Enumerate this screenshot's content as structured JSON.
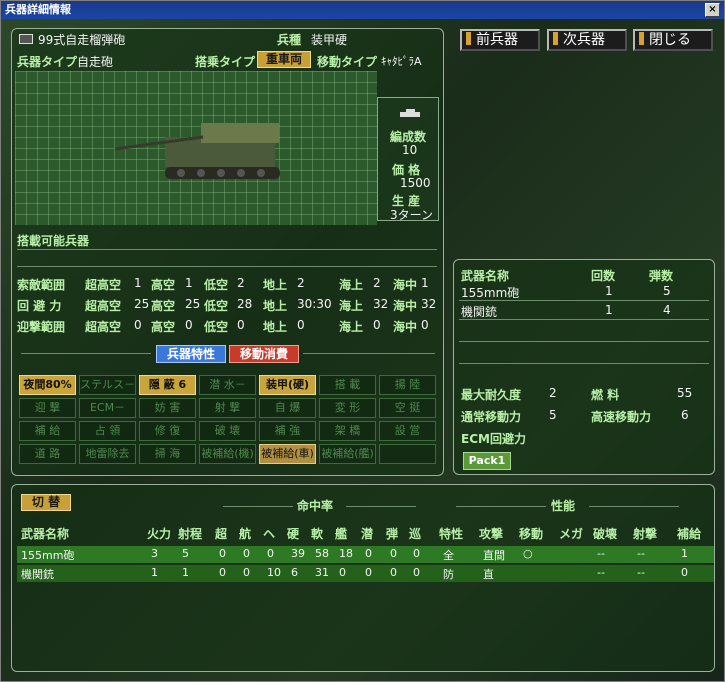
{
  "window": {
    "title": "兵器詳細情報",
    "close_glyph": "×"
  },
  "nav": {
    "prev": "前兵器",
    "next": "次兵器",
    "close": "閉じる"
  },
  "unit": {
    "name": "99式自走榴弾砲",
    "branch_label": "兵種",
    "branch": "装甲硬",
    "type_label": "兵器タイプ",
    "type": "自走砲",
    "boarding_label": "搭乗タイプ",
    "boarding": "重車両",
    "move_label": "移動タイプ",
    "move": "ｷｬﾀﾋﾟﾗA",
    "formation_label": "編成数",
    "formation": "10",
    "price_label": "価 格",
    "price": "1500",
    "production_label": "生 産",
    "production": "3ターン",
    "loadable_label": "搭載可能兵器"
  },
  "combat": {
    "search": {
      "label": "索敵範囲",
      "vals": [
        [
          "超高空",
          "1"
        ],
        [
          "高空",
          "1"
        ],
        [
          "低空",
          "2"
        ],
        [
          "地上",
          "2"
        ],
        [
          "海上",
          "2"
        ],
        [
          "海中",
          "1"
        ]
      ]
    },
    "evasion": {
      "label": "回 避 力",
      "vals": [
        [
          "超高空",
          "25"
        ],
        [
          "高空",
          "25"
        ],
        [
          "低空",
          "28"
        ],
        [
          "地上",
          "30:30"
        ],
        [
          "海上",
          "32"
        ],
        [
          "海中",
          "32"
        ]
      ]
    },
    "intercept": {
      "label": "迎撃範囲",
      "vals": [
        [
          "超高空",
          "0"
        ],
        [
          "高空",
          "0"
        ],
        [
          "低空",
          "0"
        ],
        [
          "地上",
          "0"
        ],
        [
          "海上",
          "0"
        ],
        [
          "海中",
          "0"
        ]
      ]
    }
  },
  "tabs": {
    "traits": "兵器特性",
    "move_cost": "移動消費"
  },
  "traits": [
    [
      "夜間80%",
      "ステルス－",
      "隠 蔽 6",
      "潜 水－",
      "装甲(硬)",
      "搭 載",
      "揚 陸"
    ],
    [
      "迎 撃",
      "ECM－",
      "妨 害",
      "射 撃",
      "自 爆",
      "変 形",
      "空 挺"
    ],
    [
      "補 給",
      "占 領",
      "修 復",
      "破 壊",
      "補 強",
      "架 橋",
      "設 営"
    ],
    [
      "道 路",
      "地雷除去",
      "掃 海",
      "被補給(機)",
      "被補給(車)",
      "被補給(艦)",
      ""
    ]
  ],
  "weapons_panel": {
    "headers": [
      "武器名称",
      "回数",
      "弾数"
    ],
    "rows": [
      [
        "155mm砲",
        "1",
        "5"
      ],
      [
        "機関銃",
        "1",
        "4"
      ]
    ],
    "durability_label": "最大耐久度",
    "durability": "2",
    "fuel_label": "燃 料",
    "fuel": "55",
    "move_label": "通常移動力",
    "move": "5",
    "fast_move_label": "高速移動力",
    "fast_move": "6",
    "ecm_label": "ECM回避力",
    "pack": "Pack1"
  },
  "table": {
    "switch": "切 替",
    "hit_group": "命中率",
    "perf_group": "性能",
    "headers": [
      "武器名称",
      "火力",
      "射程",
      "超",
      "航",
      "ヘ",
      "硬",
      "軟",
      "艦",
      "潜",
      "弾",
      "巡",
      "特性",
      "攻撃",
      "移動",
      "メガ",
      "破壊",
      "射撃",
      "補給"
    ],
    "rows": [
      [
        "155mm砲",
        "3",
        "5",
        "0",
        "0",
        "0",
        "39",
        "58",
        "18",
        "0",
        "0",
        "0",
        "全",
        "直間",
        "○",
        "",
        "--",
        "--",
        "1"
      ],
      [
        "機関銃",
        "1",
        "1",
        "0",
        "0",
        "10",
        "6",
        "31",
        "0",
        "0",
        "0",
        "0",
        "防",
        "直",
        "",
        "",
        "--",
        "--",
        "0"
      ]
    ]
  },
  "colors": {
    "accent": "#c9a43a",
    "title": "#1a46a8",
    "label": "#b8f0a8"
  }
}
